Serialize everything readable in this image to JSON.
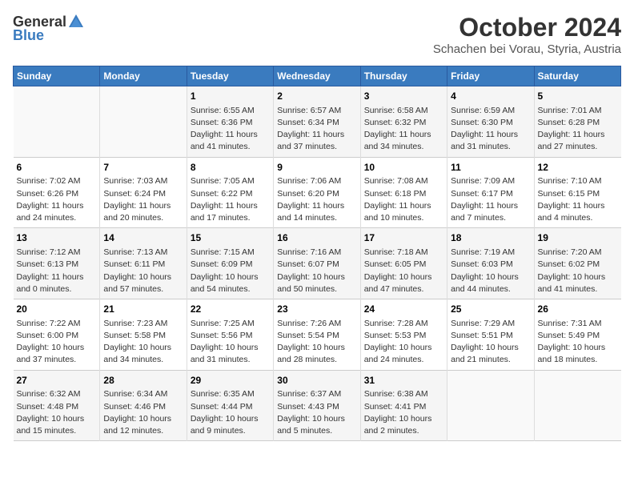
{
  "header": {
    "logo_general": "General",
    "logo_blue": "Blue",
    "month": "October 2024",
    "location": "Schachen bei Vorau, Styria, Austria"
  },
  "weekdays": [
    "Sunday",
    "Monday",
    "Tuesday",
    "Wednesday",
    "Thursday",
    "Friday",
    "Saturday"
  ],
  "weeks": [
    [
      {
        "day": "",
        "info": ""
      },
      {
        "day": "",
        "info": ""
      },
      {
        "day": "1",
        "info": "Sunrise: 6:55 AM\nSunset: 6:36 PM\nDaylight: 11 hours and 41 minutes."
      },
      {
        "day": "2",
        "info": "Sunrise: 6:57 AM\nSunset: 6:34 PM\nDaylight: 11 hours and 37 minutes."
      },
      {
        "day": "3",
        "info": "Sunrise: 6:58 AM\nSunset: 6:32 PM\nDaylight: 11 hours and 34 minutes."
      },
      {
        "day": "4",
        "info": "Sunrise: 6:59 AM\nSunset: 6:30 PM\nDaylight: 11 hours and 31 minutes."
      },
      {
        "day": "5",
        "info": "Sunrise: 7:01 AM\nSunset: 6:28 PM\nDaylight: 11 hours and 27 minutes."
      }
    ],
    [
      {
        "day": "6",
        "info": "Sunrise: 7:02 AM\nSunset: 6:26 PM\nDaylight: 11 hours and 24 minutes."
      },
      {
        "day": "7",
        "info": "Sunrise: 7:03 AM\nSunset: 6:24 PM\nDaylight: 11 hours and 20 minutes."
      },
      {
        "day": "8",
        "info": "Sunrise: 7:05 AM\nSunset: 6:22 PM\nDaylight: 11 hours and 17 minutes."
      },
      {
        "day": "9",
        "info": "Sunrise: 7:06 AM\nSunset: 6:20 PM\nDaylight: 11 hours and 14 minutes."
      },
      {
        "day": "10",
        "info": "Sunrise: 7:08 AM\nSunset: 6:18 PM\nDaylight: 11 hours and 10 minutes."
      },
      {
        "day": "11",
        "info": "Sunrise: 7:09 AM\nSunset: 6:17 PM\nDaylight: 11 hours and 7 minutes."
      },
      {
        "day": "12",
        "info": "Sunrise: 7:10 AM\nSunset: 6:15 PM\nDaylight: 11 hours and 4 minutes."
      }
    ],
    [
      {
        "day": "13",
        "info": "Sunrise: 7:12 AM\nSunset: 6:13 PM\nDaylight: 11 hours and 0 minutes."
      },
      {
        "day": "14",
        "info": "Sunrise: 7:13 AM\nSunset: 6:11 PM\nDaylight: 10 hours and 57 minutes."
      },
      {
        "day": "15",
        "info": "Sunrise: 7:15 AM\nSunset: 6:09 PM\nDaylight: 10 hours and 54 minutes."
      },
      {
        "day": "16",
        "info": "Sunrise: 7:16 AM\nSunset: 6:07 PM\nDaylight: 10 hours and 50 minutes."
      },
      {
        "day": "17",
        "info": "Sunrise: 7:18 AM\nSunset: 6:05 PM\nDaylight: 10 hours and 47 minutes."
      },
      {
        "day": "18",
        "info": "Sunrise: 7:19 AM\nSunset: 6:03 PM\nDaylight: 10 hours and 44 minutes."
      },
      {
        "day": "19",
        "info": "Sunrise: 7:20 AM\nSunset: 6:02 PM\nDaylight: 10 hours and 41 minutes."
      }
    ],
    [
      {
        "day": "20",
        "info": "Sunrise: 7:22 AM\nSunset: 6:00 PM\nDaylight: 10 hours and 37 minutes."
      },
      {
        "day": "21",
        "info": "Sunrise: 7:23 AM\nSunset: 5:58 PM\nDaylight: 10 hours and 34 minutes."
      },
      {
        "day": "22",
        "info": "Sunrise: 7:25 AM\nSunset: 5:56 PM\nDaylight: 10 hours and 31 minutes."
      },
      {
        "day": "23",
        "info": "Sunrise: 7:26 AM\nSunset: 5:54 PM\nDaylight: 10 hours and 28 minutes."
      },
      {
        "day": "24",
        "info": "Sunrise: 7:28 AM\nSunset: 5:53 PM\nDaylight: 10 hours and 24 minutes."
      },
      {
        "day": "25",
        "info": "Sunrise: 7:29 AM\nSunset: 5:51 PM\nDaylight: 10 hours and 21 minutes."
      },
      {
        "day": "26",
        "info": "Sunrise: 7:31 AM\nSunset: 5:49 PM\nDaylight: 10 hours and 18 minutes."
      }
    ],
    [
      {
        "day": "27",
        "info": "Sunrise: 6:32 AM\nSunset: 4:48 PM\nDaylight: 10 hours and 15 minutes."
      },
      {
        "day": "28",
        "info": "Sunrise: 6:34 AM\nSunset: 4:46 PM\nDaylight: 10 hours and 12 minutes."
      },
      {
        "day": "29",
        "info": "Sunrise: 6:35 AM\nSunset: 4:44 PM\nDaylight: 10 hours and 9 minutes."
      },
      {
        "day": "30",
        "info": "Sunrise: 6:37 AM\nSunset: 4:43 PM\nDaylight: 10 hours and 5 minutes."
      },
      {
        "day": "31",
        "info": "Sunrise: 6:38 AM\nSunset: 4:41 PM\nDaylight: 10 hours and 2 minutes."
      },
      {
        "day": "",
        "info": ""
      },
      {
        "day": "",
        "info": ""
      }
    ]
  ]
}
